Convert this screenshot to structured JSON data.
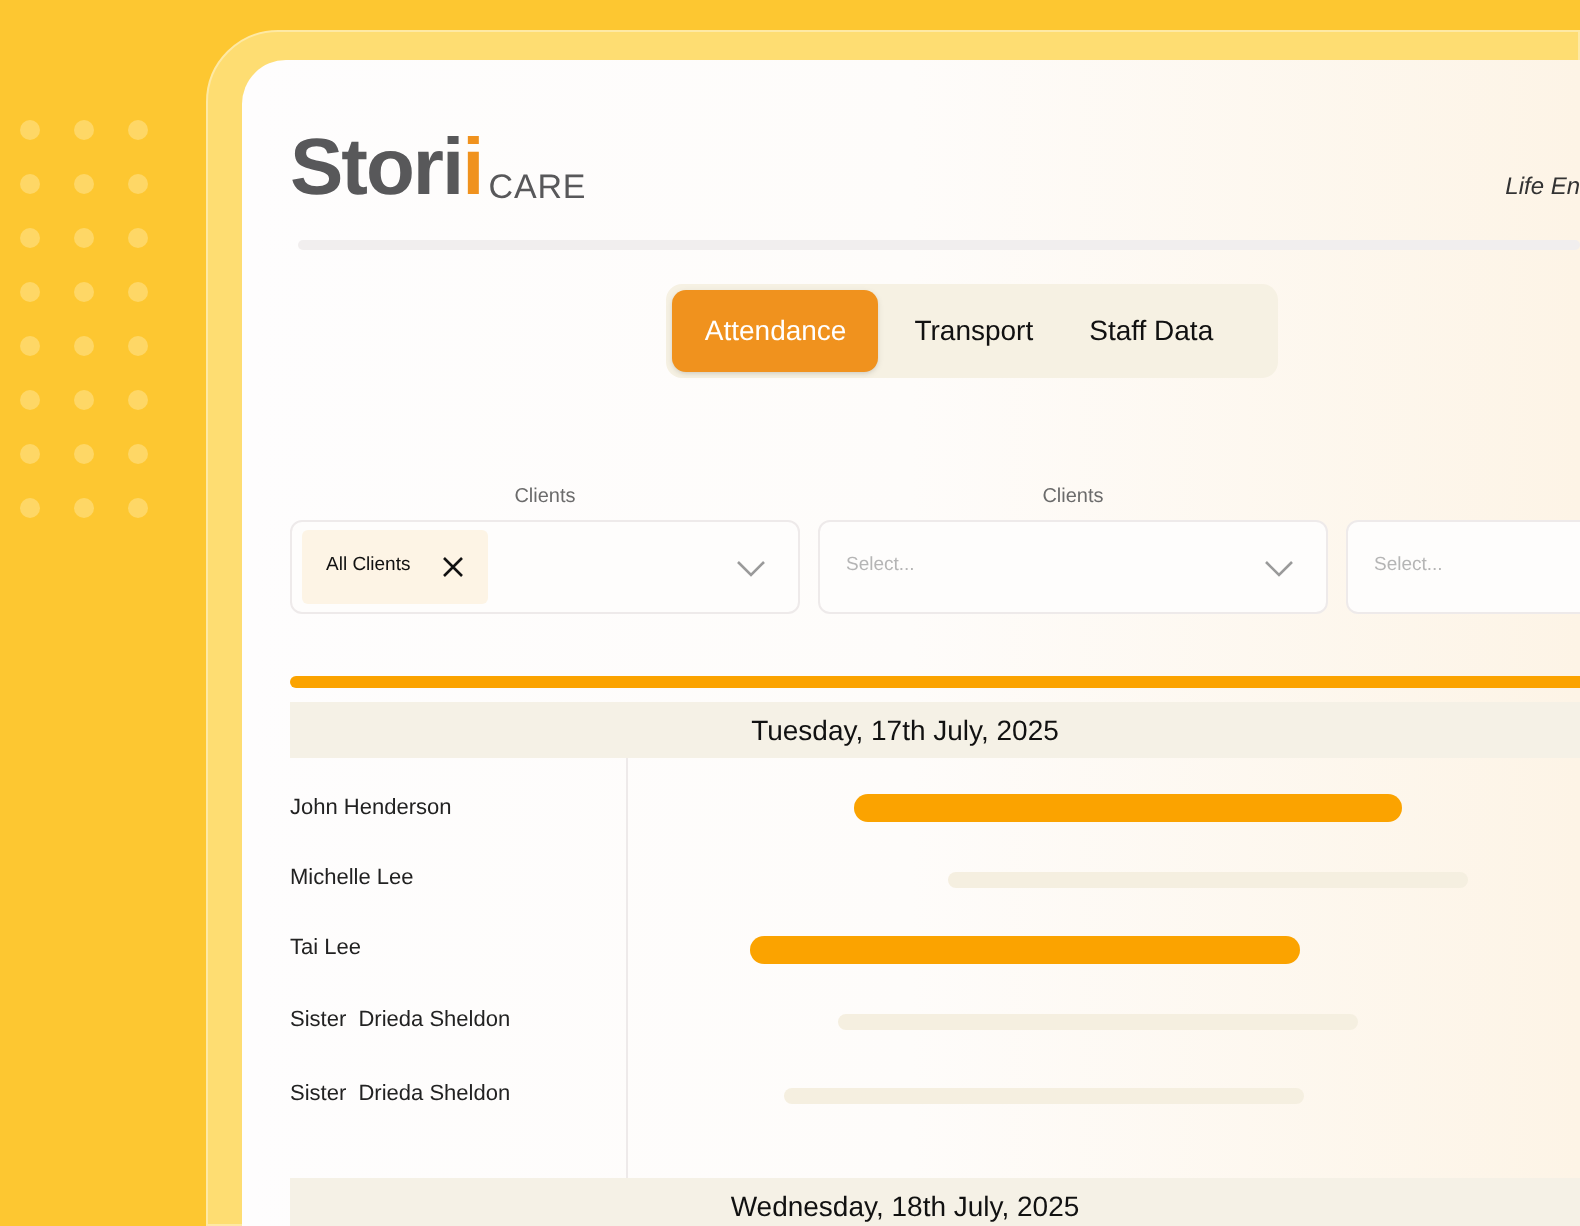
{
  "logo": {
    "word": "Storii",
    "suffix": "CARE"
  },
  "header_text": "Life En",
  "tabs": [
    {
      "label": "Attendance",
      "selected": true
    },
    {
      "label": "Transport",
      "selected": false
    },
    {
      "label": "Staff Data",
      "selected": false
    }
  ],
  "filters": [
    {
      "label": "Clients",
      "chip": "All Clients"
    },
    {
      "label": "Clients",
      "placeholder": "Select..."
    },
    {
      "placeholder": "Select..."
    }
  ],
  "days": [
    {
      "date": "Tuesday, 17th July, 2025",
      "rows": [
        {
          "name": "John Henderson",
          "present": true
        },
        {
          "name": "Michelle Lee",
          "present": false
        },
        {
          "name": "Tai Lee",
          "present": true
        },
        {
          "name": "Sister  Drieda Sheldon",
          "present": false
        },
        {
          "name": "Sister  Drieda Sheldon",
          "present": false
        }
      ]
    },
    {
      "date": "Wednesday, 18th July, 2025"
    }
  ]
}
